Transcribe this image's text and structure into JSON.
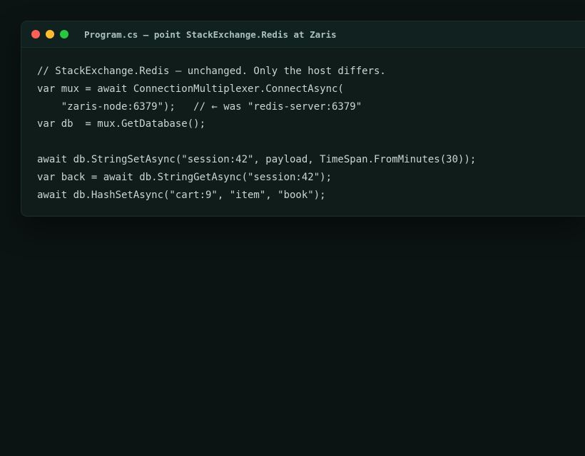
{
  "window": {
    "title": "Program.cs — point StackExchange.Redis at Zaris",
    "controls": [
      {
        "name": "close",
        "color": "#ff5f57"
      },
      {
        "name": "minimize",
        "color": "#febc2e"
      },
      {
        "name": "maximize",
        "color": "#28c840"
      }
    ]
  },
  "code": {
    "lines": [
      "// StackExchange.Redis — unchanged. Only the host differs.",
      "var mux = await ConnectionMultiplexer.ConnectAsync(",
      "    \"zaris-node:6379\");   // ← was \"redis-server:6379\"",
      "var db  = mux.GetDatabase();",
      "",
      "await db.StringSetAsync(\"session:42\", payload, TimeSpan.FromMinutes(30));",
      "var back = await db.StringGetAsync(\"session:42\");",
      "await db.HashSetAsync(\"cart:9\", \"item\", \"book\");"
    ]
  }
}
